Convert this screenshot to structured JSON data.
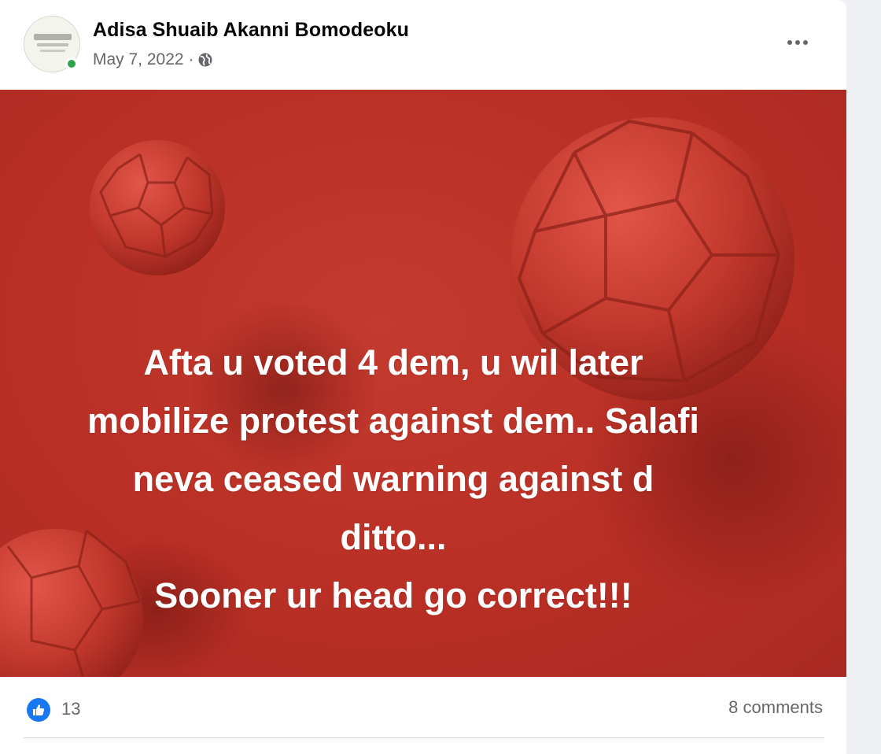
{
  "post": {
    "author": "Adisa Shuaib Akanni Bomodeoku",
    "date": "May 7, 2022",
    "separator": "·",
    "privacy_icon": "globe-icon",
    "more_icon": "more-options-icon",
    "text_lines": [
      "Afta u voted 4 dem, u wil later",
      "mobilize protest against dem.. Salafi",
      "neva ceased warning against d",
      "ditto...",
      "Sooner ur head go correct!!!"
    ],
    "background_color": "#b92f25",
    "reactions": {
      "icon": "like-icon",
      "count": "13"
    },
    "comments_label": "8 comments"
  },
  "colors": {
    "like_blue": "#1877f2",
    "online_green": "#31a24c",
    "muted_text": "#65676b"
  }
}
